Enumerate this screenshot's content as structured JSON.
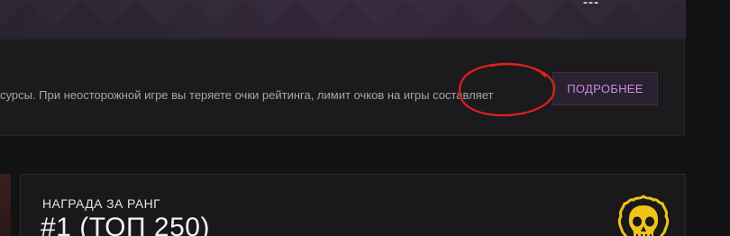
{
  "banner": {
    "dashes": "---"
  },
  "notice": {
    "text": "сурсы. При неосторожной игре вы теряете очки рейтинга, лимит очков на игры составляет",
    "more_button": "ПОДРОБНЕЕ"
  },
  "reward": {
    "label": "НАГРАДА ЗА РАНГ",
    "value": "#1 (ТОП 250)"
  },
  "icons": {
    "rank_badge": "skull-badge-icon"
  },
  "colors": {
    "accent_purple": "#c78be0",
    "annotation_red": "#e0201b",
    "badge_gold": "#f0c21a",
    "background": "#131214"
  }
}
